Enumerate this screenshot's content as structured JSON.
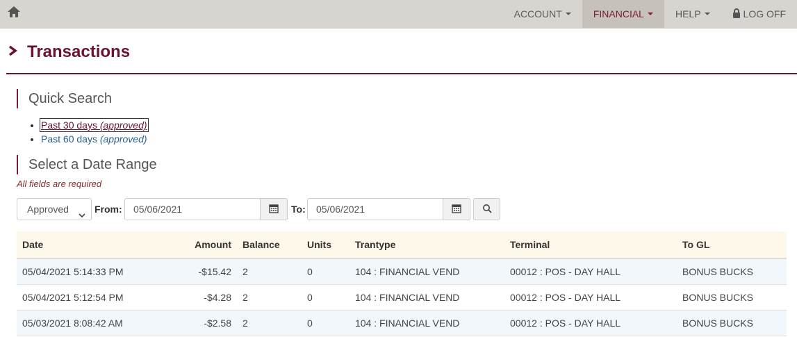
{
  "nav": {
    "items": [
      {
        "label": "ACCOUNT"
      },
      {
        "label": "FINANCIAL"
      },
      {
        "label": "HELP"
      },
      {
        "label": "LOG OFF"
      }
    ]
  },
  "page": {
    "title": "Transactions"
  },
  "quick_search": {
    "heading": "Quick Search",
    "links": [
      {
        "text": "Past 30 days",
        "note": "(approved)"
      },
      {
        "text": "Past 60 days",
        "note": "(approved)"
      }
    ]
  },
  "date_range": {
    "heading": "Select a Date Range",
    "required_note": "All fields are required",
    "status_value": "Approved",
    "from_label": "From:",
    "from_value": "05/06/2021",
    "to_label": "To:",
    "to_value": "05/06/2021"
  },
  "table": {
    "headers": [
      "Date",
      "Amount",
      "Balance",
      "Units",
      "Trantype",
      "Terminal",
      "To GL"
    ],
    "rows": [
      [
        "05/04/2021 5:14:33 PM",
        "-$15.42",
        "2",
        "0",
        "104 : FINANCIAL VEND",
        "00012 : POS - DAY HALL",
        "BONUS BUCKS"
      ],
      [
        "05/04/2021 5:12:54 PM",
        "-$4.28",
        "2",
        "0",
        "104 : FINANCIAL VEND",
        "00012 : POS - DAY HALL",
        "BONUS BUCKS"
      ],
      [
        "05/03/2021 8:08:42 AM",
        "-$2.58",
        "2",
        "0",
        "104 : FINANCIAL VEND",
        "00012 : POS - DAY HALL",
        "BONUS BUCKS"
      ]
    ]
  },
  "colors": {
    "brand": "#6b1230",
    "topbar": "#d8d4cf",
    "link": "#2a5f8f",
    "header_bg": "#fdf8ea",
    "alt_row": "#f2f7fc"
  },
  "icons": [
    "home-icon",
    "caret-down-icon",
    "lock-icon",
    "chevron-right-icon",
    "calendar-icon",
    "search-icon"
  ]
}
